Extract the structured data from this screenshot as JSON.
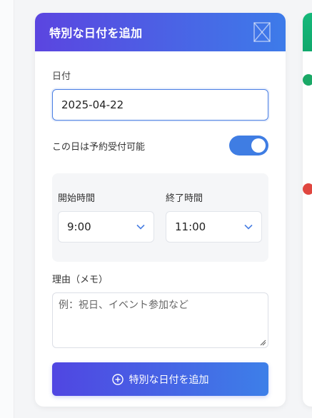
{
  "form": {
    "title": "特別な日付を追加",
    "date_label": "日付",
    "date_value": "2025-04-22",
    "available_label": "この日は予約受付可能",
    "available_on": true,
    "start_label": "開始時間",
    "start_value": "9:00",
    "end_label": "終了時間",
    "end_value": "11:00",
    "memo_label": "理由（メモ）",
    "memo_placeholder": "例：祝日、イベント参加など",
    "submit_label": "特別な日付を追加"
  },
  "colors": {
    "header_start": "#5b45e0",
    "header_end": "#3d7be9",
    "toggle_on": "#3f7de3",
    "right_header": "#15b87a",
    "status_green": "#1aa866",
    "status_red": "#e0463f"
  },
  "icons": {
    "close": "close-box-icon",
    "chevron": "chevron-down-icon",
    "plus": "plus-circle-icon"
  }
}
